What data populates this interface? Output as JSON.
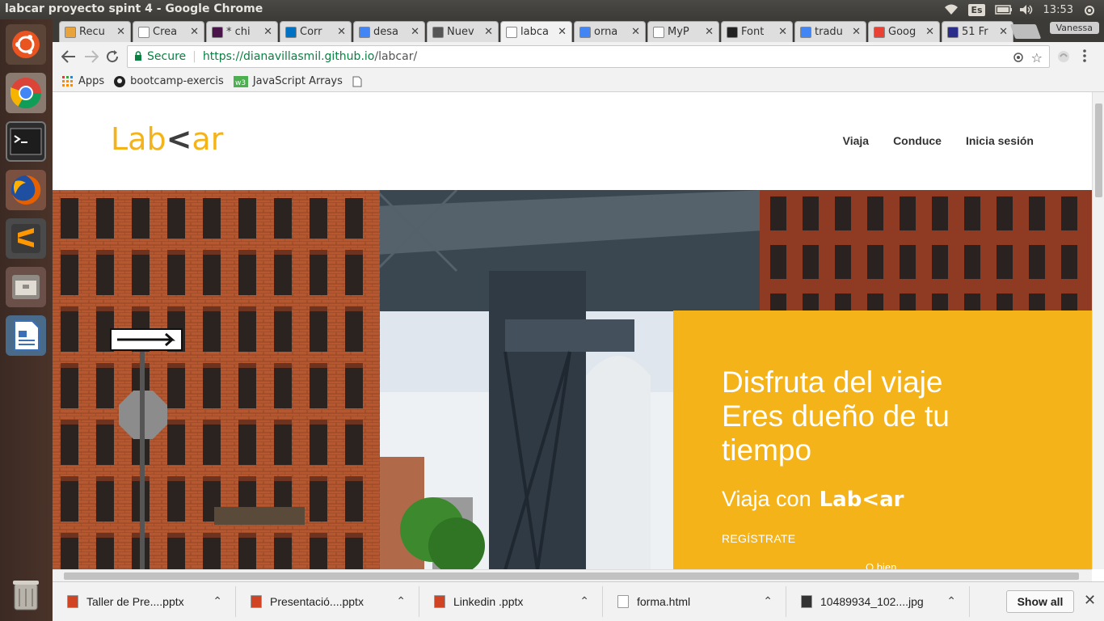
{
  "os": {
    "window_title": "labcar proyecto spint 4 - Google Chrome",
    "keyboard_lang": "Es",
    "clock": "13:53",
    "user": "Vanessa"
  },
  "launcher": {
    "items": [
      {
        "name": "ubuntu-dash-icon"
      },
      {
        "name": "chrome-icon"
      },
      {
        "name": "terminal-icon"
      },
      {
        "name": "firefox-icon"
      },
      {
        "name": "sublime-text-icon"
      },
      {
        "name": "files-icon"
      },
      {
        "name": "writer-icon"
      },
      {
        "name": "trash-icon"
      }
    ]
  },
  "tabs": [
    {
      "label": "Recu",
      "color": "#e8a33d"
    },
    {
      "label": "Crea",
      "color": "#ffffff"
    },
    {
      "label": "* chi",
      "color": "#4a154b"
    },
    {
      "label": "Corr",
      "color": "#0072c6"
    },
    {
      "label": "desa",
      "color": "#4285f4"
    },
    {
      "label": "Nuev",
      "color": "#555555"
    },
    {
      "label": "labca",
      "color": "#ffffff"
    },
    {
      "label": "orna",
      "color": "#4285f4"
    },
    {
      "label": "MyP",
      "color": "#ffffff"
    },
    {
      "label": "Font",
      "color": "#222222"
    },
    {
      "label": "tradu",
      "color": "#4285f4"
    },
    {
      "label": "Goog",
      "color": "#e94235"
    },
    {
      "label": "51 Fr",
      "color": "#2b2d8a"
    }
  ],
  "toolbar": {
    "secure_label": "Secure",
    "url_host": "https://dianavillasmil.github.io",
    "url_path": "/labcar/"
  },
  "bookmarks": [
    {
      "label": "Apps"
    },
    {
      "label": "bootcamp-exercis"
    },
    {
      "label": "JavaScript Arrays"
    },
    {
      "label": ""
    }
  ],
  "site": {
    "logo_left": "Lab",
    "logo_chev": "<",
    "logo_right": "ar",
    "nav": [
      "Viaja",
      "Conduce",
      "Inicia sesión"
    ],
    "promo": {
      "headline_1": "Disfruta del viaje",
      "headline_2": "Eres dueño de tu tiempo",
      "sub_prefix": "Viaja con",
      "sub_logo_left": "Lab",
      "sub_logo_chev": "<",
      "sub_logo_right": "ar",
      "cta": "REGÍSTRATE",
      "or": "O bien"
    }
  },
  "downloads": [
    {
      "name": "Taller de Pre....pptx",
      "kind": "pptx"
    },
    {
      "name": "Presentació....pptx",
      "kind": "pptx"
    },
    {
      "name": "Linkedin .pptx",
      "kind": "pptx"
    },
    {
      "name": "forma.html",
      "kind": "html"
    },
    {
      "name": "10489934_102....jpg",
      "kind": "jpg"
    }
  ],
  "download_bar": {
    "show_all": "Show all"
  },
  "colors": {
    "brand_yellow": "#f5b31a",
    "secure_green": "#0b8043"
  }
}
